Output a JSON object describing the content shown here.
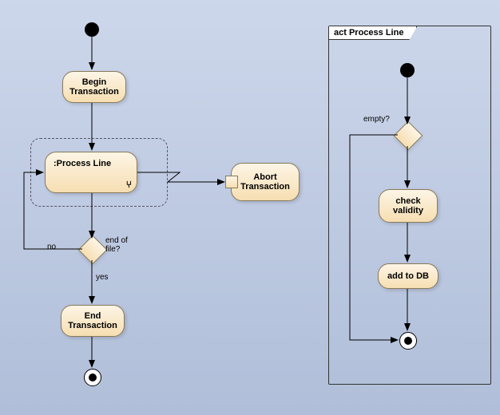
{
  "left": {
    "begin": "Begin\nTransaction",
    "process": ":Process Line",
    "abort": "Abort\nTransaction",
    "end": "End\nTransaction",
    "decision_label": "end of\nfile?",
    "yes": "yes",
    "no": "no"
  },
  "right": {
    "frame_title": "act Process Line",
    "decision_label": "empty?",
    "check": "check\nvalidity",
    "add": "add to DB"
  }
}
